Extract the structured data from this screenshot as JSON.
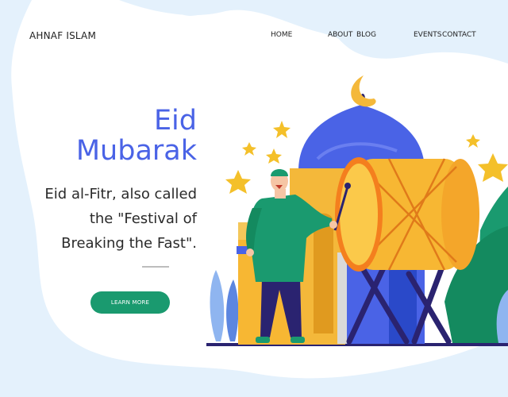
{
  "brand": "AHNAF ISLAM",
  "nav": {
    "home": "HOME",
    "about": "ABOUT",
    "blog": "BLOG",
    "events": "EVENTS",
    "contact": "CONTACT"
  },
  "hero": {
    "title_line1": "Eid",
    "title_line2": "Mubarak",
    "desc_line1": "Eid al-Fitr, also called",
    "desc_line2": "the \"Festival of",
    "desc_line3": "Breaking the Fast\".",
    "button_label": "LEARN MORE"
  },
  "colors": {
    "accent": "#4a63e6",
    "button": "#1a9a6f",
    "background_blob": "#e4f1fc"
  },
  "illustration": {
    "icons": [
      "crescent-moon-icon",
      "star-icon",
      "drum-icon",
      "mosque-dome-icon",
      "man-figure-icon",
      "leaf-icon"
    ]
  }
}
